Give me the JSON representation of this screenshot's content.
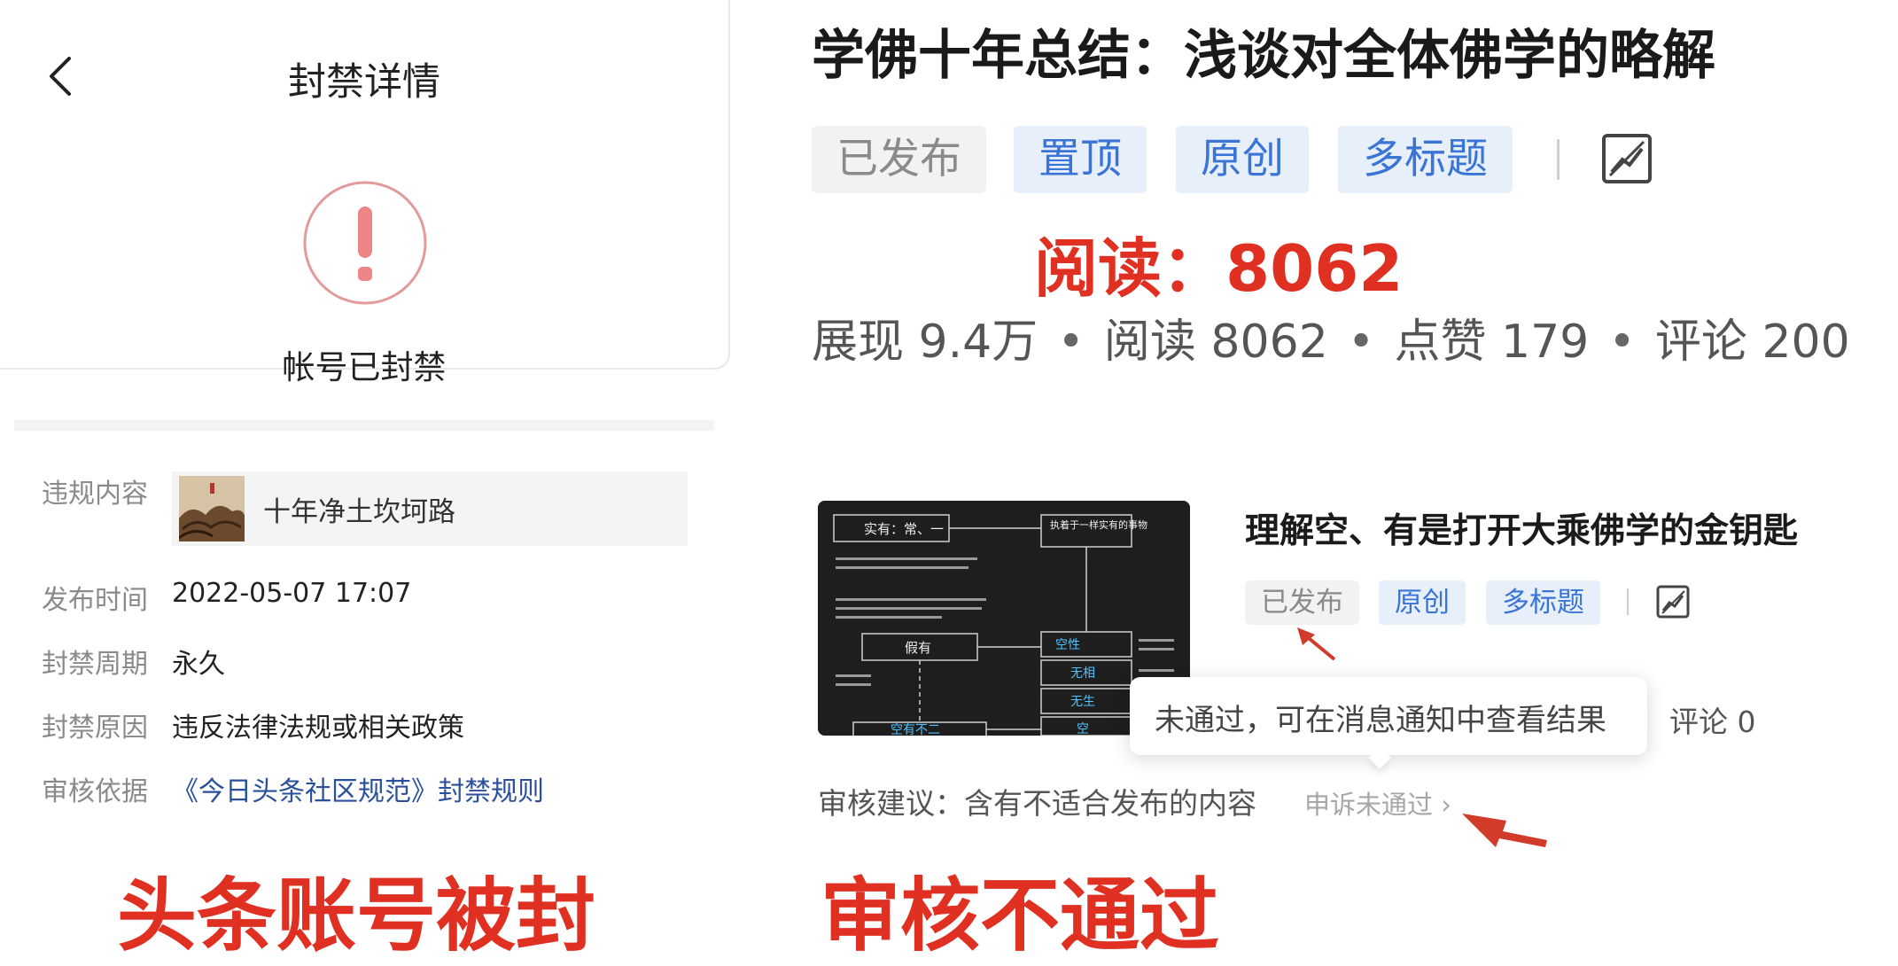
{
  "left_panel": {
    "title": "封禁详情",
    "status_text": "帐号已封禁",
    "rows": {
      "violation_label": "违规内容",
      "violation_content": "十年净土坎坷路",
      "publish_label": "发布时间",
      "publish_value": "2022-05-07 17:07",
      "period_label": "封禁周期",
      "period_value": "永久",
      "reason_label": "封禁原因",
      "reason_value": "违反法律法规或相关政策",
      "basis_label": "审核依据",
      "basis_value": "《今日头条社区规范》封禁规则"
    },
    "caption": "头条账号被封"
  },
  "article1": {
    "title": "学佛十年总结：浅谈对全体佛学的略解",
    "tags": [
      "已发布",
      "置顶",
      "原创",
      "多标题"
    ],
    "red_annotation": "阅读：8062",
    "stats": {
      "impressions": "展现 9.4万",
      "reads": "阅读 8062",
      "likes": "点赞 179",
      "comments": "评论 200"
    }
  },
  "article2": {
    "title": "理解空、有是打开大乘佛学的金钥匙",
    "tags": [
      "已发布",
      "原创",
      "多标题"
    ],
    "tooltip": "未通过，可在消息通知中查看结果",
    "comments": "评论 0",
    "review_label": "审核建议：含有不适合发布的内容",
    "appeal": "申诉未通过 ›",
    "thumbnail_text": {
      "box1": "实有：常、一",
      "box2": "执着于一样实有的事物",
      "box3": "假有",
      "box4": "空性",
      "box5": "无相",
      "box6": "无生",
      "box7": "空",
      "box8": "空有不二"
    },
    "caption": "审核不通过"
  },
  "colors": {
    "red_annotation": "#e03022",
    "blue_tag_text": "#3a74d6",
    "blue_tag_bg": "#e7effb",
    "gray_tag_bg": "#f2f2f2",
    "link": "#2a4f9c"
  }
}
